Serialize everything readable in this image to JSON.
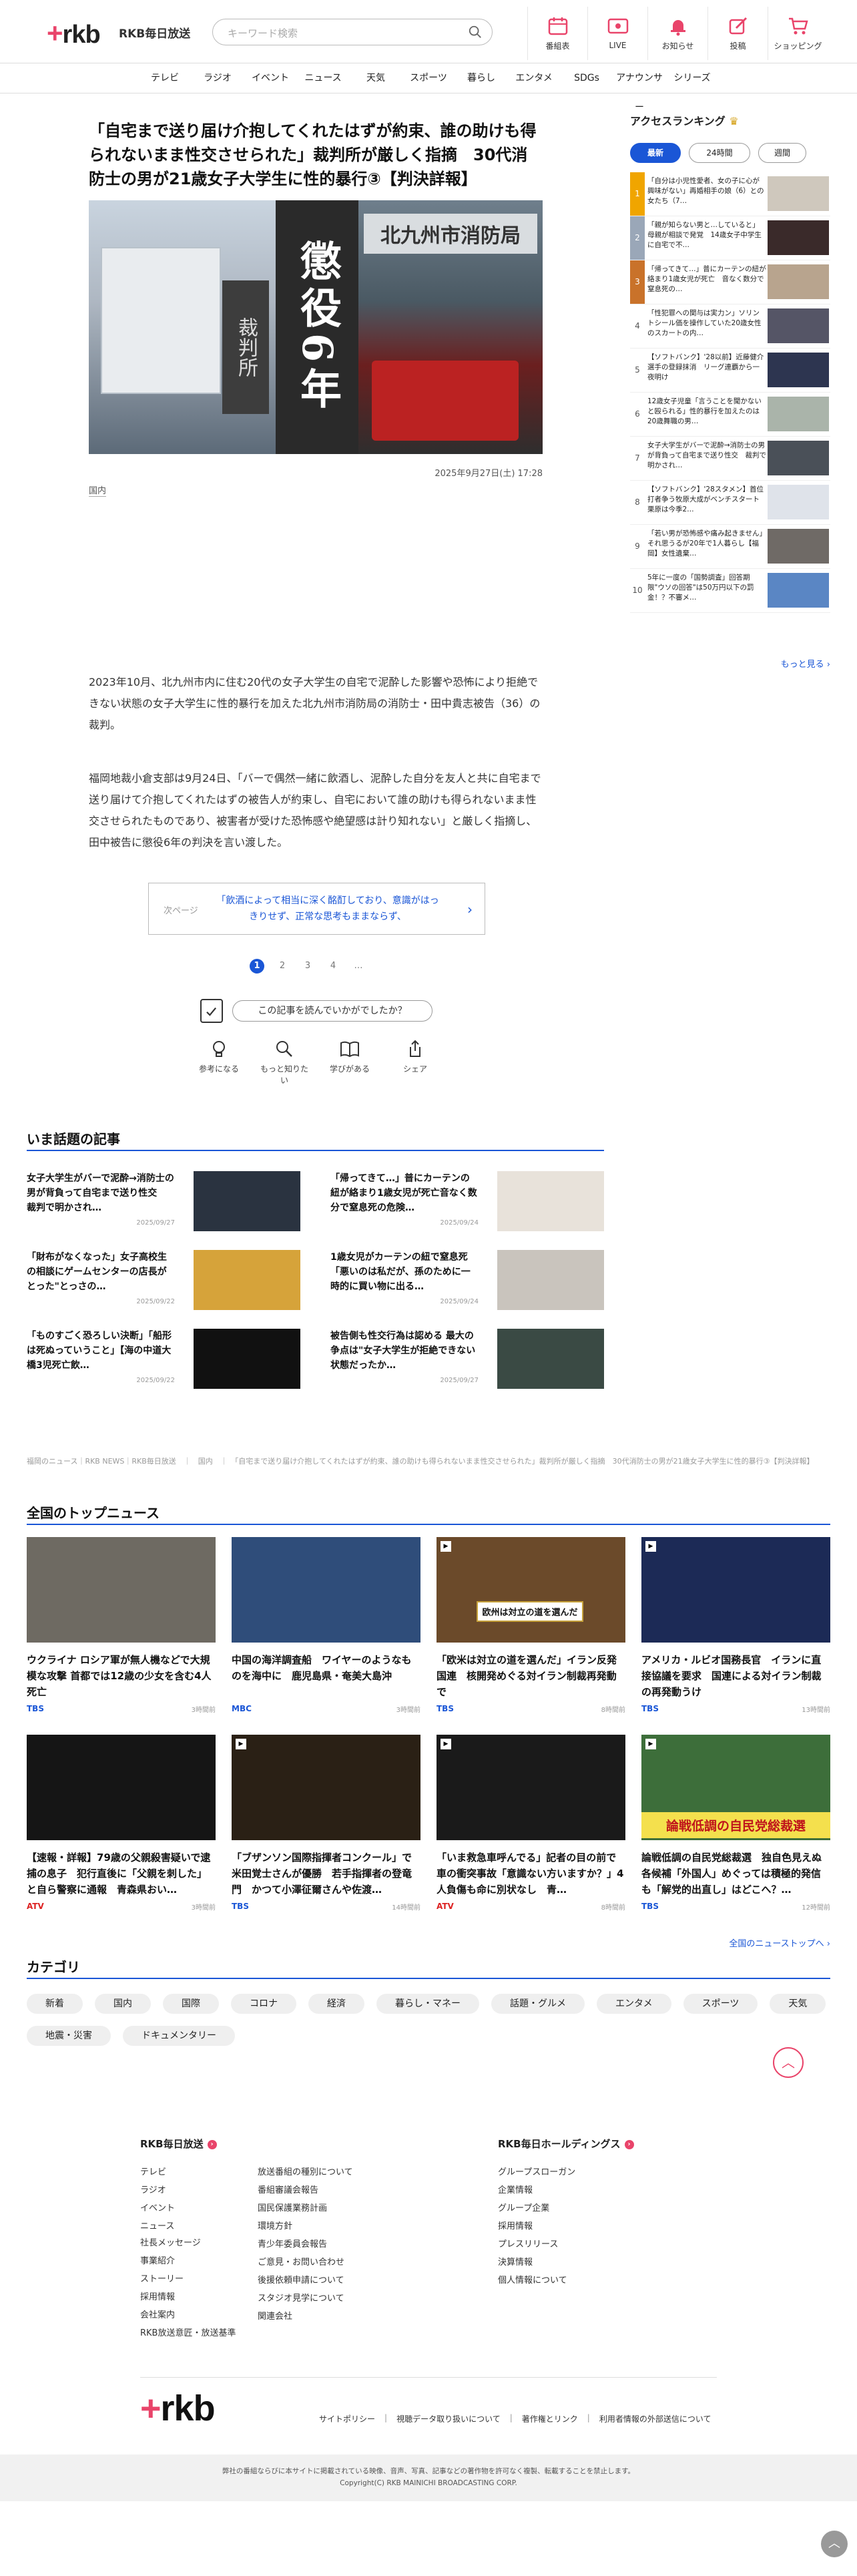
{
  "header": {
    "logo": "rkb",
    "logo_plus": "+",
    "station": "RKB毎日放送",
    "search_placeholder": "キーワード検索",
    "icons": [
      {
        "label": "番組表",
        "icon": "calendar-icon"
      },
      {
        "label": "LIVE",
        "icon": "live-icon"
      },
      {
        "label": "お知らせ",
        "icon": "bell-icon"
      },
      {
        "label": "投稿",
        "icon": "pen-icon"
      },
      {
        "label": "ショッピング",
        "icon": "cart-icon"
      }
    ]
  },
  "gnav": [
    "テレビ",
    "ラジオ",
    "イベント",
    "ニュース",
    "天気",
    "スポーツ",
    "暮らし",
    "エンタメ",
    "SDGs",
    "アナウンサー",
    "シリーズ"
  ],
  "article": {
    "title": "「自宅まで送り届け介抱してくれたはずが約束、誰の助けも得られないまま性交させられた」裁判所が厳しく指摘　30代消防士の男が21歳女子大学生に性的暴行③【判決詳報】",
    "hero_sign": "裁判所",
    "hero_center": "懲役6年",
    "hero_station": "北九州市消防局",
    "date": "2025年9月27日(土) 17:28",
    "category": "国内",
    "p1": "2023年10月、北九州市内に住む20代の女子大学生の自宅で泥酔した影響や恐怖により拒絶できない状態の女子大学生に性的暴行を加えた北九州市消防局の消防士・田中貴志被告（36）の裁判。",
    "p2": "福岡地裁小倉支部は9月24日、「バーで偶然一緒に飲酒し、泥酔した自分を友人と共に自宅まで送り届けて介抱してくれたはずの被告人が約束し、自宅において誰の助けも得られないまま性交させられたものであり、被害者が受けた恐怖感や絶望感は計り知れない」と厳しく指摘し、田中被告に懲役6年の判決を言い渡した。",
    "next_label": "次ページ",
    "next_text": "「飲酒によって相当に深く酩酊しており、意識がはっきりせず、正常な思考もままならず、",
    "next_arrow": "›",
    "pages": [
      "1",
      "2",
      "3",
      "4",
      "…"
    ],
    "feedback_q": "この記事を読んでいかがでしたか？",
    "reactions": [
      {
        "label": "参考になる",
        "icon": "bulb-icon"
      },
      {
        "label": "もっと知りたい",
        "icon": "magnifier-icon"
      },
      {
        "label": "学びがある",
        "icon": "book-icon"
      },
      {
        "label": "シェア",
        "icon": "share-icon"
      }
    ]
  },
  "ranking": {
    "title": "アクセスランキング",
    "crown": "♛",
    "tabs": [
      "最新",
      "24時間",
      "週間"
    ],
    "items": [
      {
        "num": "1",
        "text": "「自分は小児性愛者、女の子に心が興味がない」再婚相手の娘（6）との女たち（7…",
        "color": "#f0a500"
      },
      {
        "num": "2",
        "text": "「親が知らない男と…していると」母親が相談で発覚　14歳女子中学生に自宅で不…",
        "color": "#9aa7b8"
      },
      {
        "num": "3",
        "text": "「帰ってきて…」普にカーテンの紐が絡まり1歳女児が死亡　音なく数分で窒息死の…",
        "color": "#c9722a"
      },
      {
        "num": "4",
        "text": "「性犯罪への関与は実力ン」ソリントシール価を操作していた20歳女性のスカートの内…",
        "color": ""
      },
      {
        "num": "5",
        "text": "【ソフトバンク】'28以前】近藤健介選手の登録抹消　リーグ連覇から一夜明け",
        "color": ""
      },
      {
        "num": "6",
        "text": "12歳女子児童「言うことを聞かないと殴られる」性的暴行を加えたのは20歳舞職の男…",
        "color": ""
      },
      {
        "num": "7",
        "text": "女子大学生がバーで泥酔→消防士の男が背負って自宅まで送り性交　裁判で明かされ…",
        "color": ""
      },
      {
        "num": "8",
        "text": "【ソフトバンク】'28スタメン】首位打者争う牧原大成がベンチスタート　栗原は今季2…",
        "color": ""
      },
      {
        "num": "9",
        "text": "「若い男が恐怖感や痛み起きません」それ思うるが20年で1人暮らし【福岡】女性遺棄…",
        "color": ""
      },
      {
        "num": "10",
        "text": "5年に一度の「国勢調査」回答期限\"ウソの回答\"は50万円以下の罰金！？不審メ…",
        "color": ""
      }
    ],
    "more": "もっと見る ›"
  },
  "trending": {
    "title": "いま話題の記事",
    "items": [
      {
        "text": "女子大学生がバーで泥酔→消防士の男が背負って自宅まで送り性交　裁判で明かされ…",
        "date": "2025/09/27"
      },
      {
        "text": "「帰ってきて…」普にカーテンの紐が絡まり1歳女児が死亡音なく数分で窒息死の危険…",
        "date": "2025/09/24"
      },
      {
        "text": "「財布がなくなった」女子高校生の相談にゲームセンターの店長がとった\"とっさの…",
        "date": "2025/09/22"
      },
      {
        "text": "1歳女児がカーテンの紐で窒息死「悪いのは私だが、孫のために一時的に買い物に出る…",
        "date": "2025/09/24"
      },
      {
        "text": "「ものすごく恐ろしい決断」「船形は死ぬっていうこと」【海の中道大橋3児死亡飲…",
        "date": "2025/09/22"
      },
      {
        "text": "被告側も性交行為は認める 最大の争点は\"女子大学生が拒絶できない状態だったか…",
        "date": "2025/09/27"
      }
    ]
  },
  "breadcrumb": "福岡のニュース｜RKB NEWS｜RKB毎日放送　｜　国内　｜　「自宅まで送り届け介抱してくれたはずが約束、誰の助けも得られないまま性交させられた」裁判所が厳しく指摘　30代消防士の男が21歳女子大学生に性的暴行③【判決詳報】",
  "topnews": {
    "title": "全国のトップニュース",
    "items": [
      {
        "text": "ウクライナ ロシア軍が無人機などで大規模な攻撃 首都では12歳の少女を含む4人死亡",
        "src": "TBS",
        "src_color": "#1a56d6",
        "date": "3時間前"
      },
      {
        "text": "中国の海洋調査船　ワイヤーのようなものを海中に　鹿児島県・奄美大島沖",
        "src": "MBC",
        "src_color": "#1a56d6",
        "date": "3時間前"
      },
      {
        "text": "「欧米は対立の道を選んだ」イラン反発　国連　核開発めぐる対イラン制裁再発動で",
        "src": "TBS",
        "src_color": "#1a56d6",
        "date": "8時間前"
      },
      {
        "text": "アメリカ・ルビオ国務長官　イランに直接協議を要求　国連による対イラン制裁の再発動うけ",
        "src": "TBS",
        "src_color": "#1a56d6",
        "date": "13時間前"
      },
      {
        "text": "【速報・詳報】79歳の父親殺害疑いで逮捕の息子　犯行直後に「父親を刺した」と自ら警察に通報　青森県おい…",
        "src": "ATV",
        "src_color": "#d22",
        "date": "3時間前"
      },
      {
        "text": "「ブザンソン国際指揮者コンクール」で米田覚士さんが優勝　若手指揮者の登竜門　かつて小澤征爾さんや佐渡…",
        "src": "TBS",
        "src_color": "#1a56d6",
        "date": "14時間前"
      },
      {
        "text": "「いま救急車呼んでる」記者の目の前で車の衝突事故「意識ない方いますか？」4人負傷も命に別状なし　青…",
        "src": "ATV",
        "src_color": "#d22",
        "date": "8時間前"
      },
      {
        "text": "論戦低調の自民党総裁選　独自色見えぬ各候補「外国人」めぐっては積極的発信も「解党的出直し」はどこへ？…",
        "src": "TBS",
        "src_color": "#1a56d6",
        "date": "12時間前"
      }
    ],
    "overlay_3": "欧州は対立の道を選んだ",
    "overlay_8": "論戦低調の自民党総裁選",
    "all_link": "全国のニューストップへ ›"
  },
  "categories": {
    "title": "カテゴリ",
    "items": [
      "新着",
      "国内",
      "国際",
      "コロナ",
      "経済",
      "暮らし・マネー",
      "話題・グルメ",
      "エンタメ",
      "スポーツ",
      "天気",
      "地震・災害",
      "ドキュメンタリー"
    ]
  },
  "footer": {
    "rkb_title": "RKB毎日放送",
    "hd_title": "RKB毎日ホールディングス",
    "col1": [
      "テレビ",
      "ラジオ",
      "イベント",
      "ニュース"
    ],
    "col1b": [
      "社長メッセージ",
      "事業紹介",
      "ストーリー",
      "採用情報",
      "会社案内",
      "RKB放送意匠・放送基準"
    ],
    "col2": [
      "放送番組の種別について",
      "番組審議会報告",
      "国民保護業務計画",
      "環境方針",
      "青少年委員会報告",
      "ご意見・お問い合わせ",
      "後援依頼申請について",
      "スタジオ見学について",
      "関連会社"
    ],
    "col3": [
      "グループスローガン",
      "企業情報",
      "グループ企業",
      "採用情報",
      "プレスリリース",
      "決算情報",
      "個人情報について"
    ],
    "links": [
      "サイトポリシー",
      "視聴データ取り扱いについて",
      "著作権とリンク",
      "利用者情報の外部送信について"
    ],
    "copy1": "弊社の番組ならびに本サイトに掲載されている映像、音声、写真、記事などの著作物を許可なく複製、転載することを禁止します。",
    "copy2": "Copyright(C) RKB MAINICHI BROADCASTING CORP."
  }
}
